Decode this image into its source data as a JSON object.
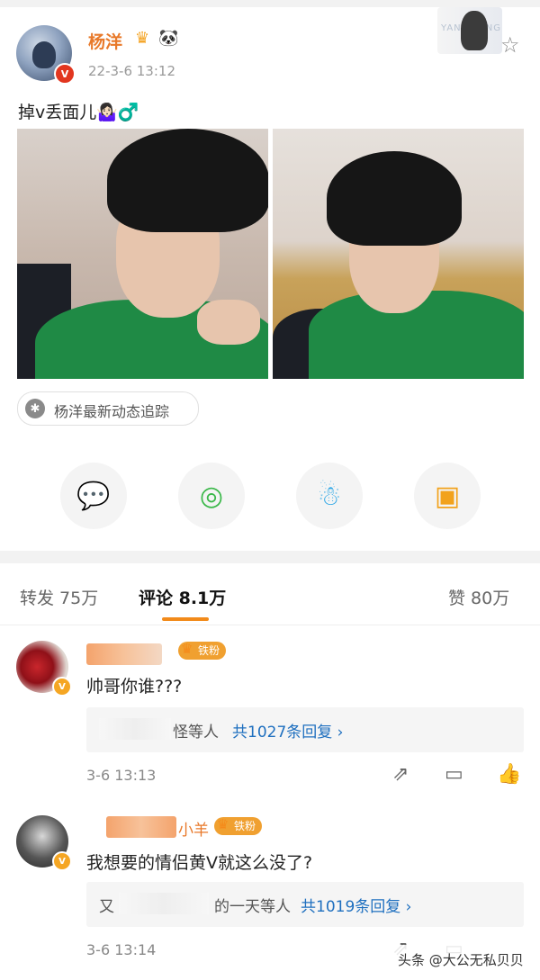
{
  "post": {
    "username": "杨洋",
    "time": "22-3-6 13:12",
    "text": "掉v丢面儿🤷🏻‍♀️♂️",
    "header_card_text": "YANG YANG",
    "tracker_label": "杨洋最新动态追踪",
    "verified_badge": "V"
  },
  "share_icons": [
    "wechat-icon",
    "moments-icon",
    "qq-icon",
    "save-image-icon"
  ],
  "tabs": {
    "repost": "转发 75万",
    "comments": "评论 8.1万",
    "likes": "赞 80万"
  },
  "comments": [
    {
      "name": "",
      "fan_badge": "铁粉",
      "text": "帅哥你谁???",
      "replies_suffix": "怪等人",
      "replies_count": "共1027条回复 ›",
      "time": "3-6 13:13"
    },
    {
      "name": "小羊",
      "fan_badge": "铁粉",
      "text": "我想要的情侣黄V就这么没了?",
      "replies_prefix": "又",
      "replies_suffix": "的一天等人",
      "replies_count": "共1019条回复 ›",
      "time": "3-6 13:14"
    }
  ],
  "watermark": "头条 @大公无私贝贝",
  "colors": {
    "accent": "#e8792a",
    "link": "#1e6fbf",
    "badge": "#f0a030"
  }
}
